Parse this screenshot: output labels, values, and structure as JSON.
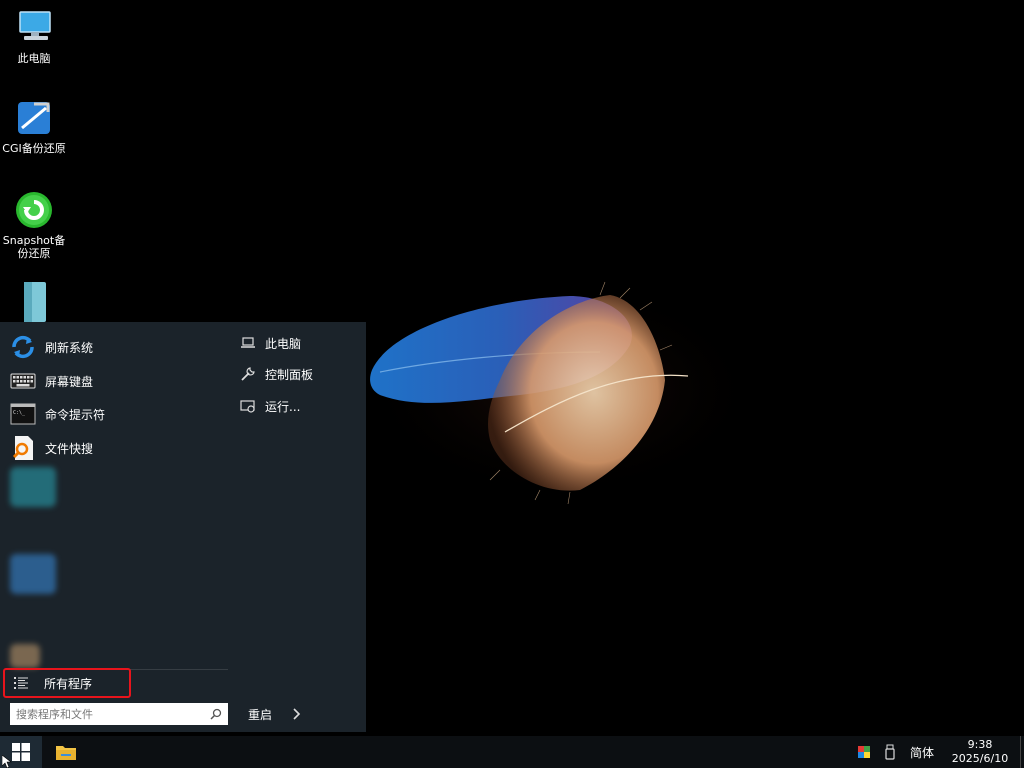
{
  "desktop": {
    "icons": [
      {
        "label": "此电脑",
        "icon": "computer-icon"
      },
      {
        "label": "CGI备份还原",
        "icon": "cgi-backup-icon"
      },
      {
        "label": "Snapshot备份还原",
        "icon": "snapshot-icon"
      }
    ]
  },
  "start_menu": {
    "left_items": [
      {
        "label": "刷新系统",
        "icon": "refresh-icon"
      },
      {
        "label": "屏幕键盘",
        "icon": "keyboard-icon"
      },
      {
        "label": "命令提示符",
        "icon": "cmd-icon"
      },
      {
        "label": "文件快搜",
        "icon": "file-search-icon"
      }
    ],
    "all_programs_label": "所有程序",
    "search_placeholder": "搜索程序和文件",
    "right_items": [
      {
        "label": "此电脑",
        "icon": "laptop-icon"
      },
      {
        "label": "控制面板",
        "icon": "wrench-icon"
      },
      {
        "label": "运行...",
        "icon": "run-icon"
      }
    ],
    "restart_label": "重启"
  },
  "taskbar": {
    "ime_label": "简体",
    "time": "9:38",
    "date": "2025/6/10"
  }
}
